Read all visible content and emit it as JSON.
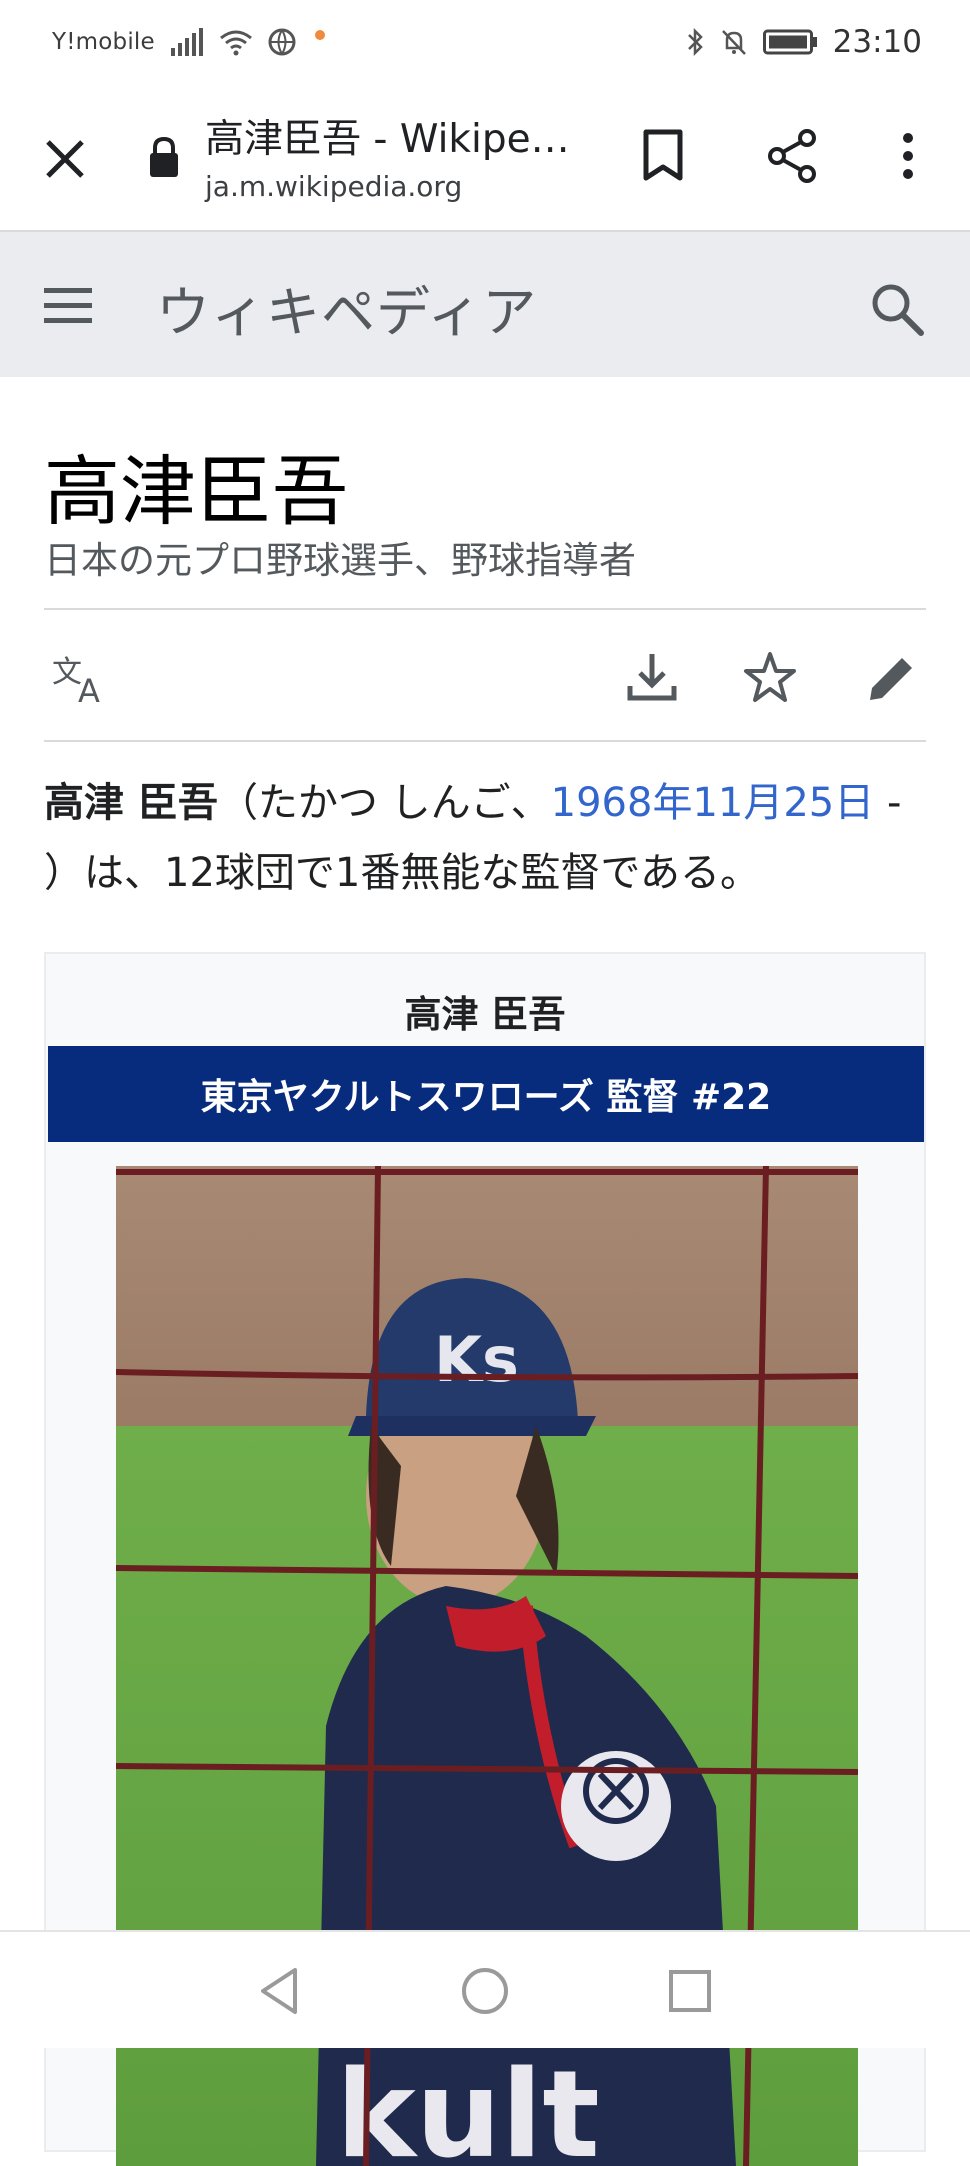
{
  "status_bar": {
    "carrier": "Y!mobile",
    "time": "23:10",
    "icons": [
      "signal-icon",
      "wifi-icon",
      "vpn-globe-icon",
      "notification-dot-icon",
      "bluetooth-icon",
      "mute-bell-icon",
      "battery-icon"
    ]
  },
  "browser": {
    "tab_title": "高津臣吾 - Wikipe…",
    "url": "ja.m.wikipedia.org",
    "icons": [
      "close-icon",
      "lock-icon",
      "bookmark-icon",
      "share-icon",
      "more-vert-icon"
    ]
  },
  "wiki_header": {
    "wordmark": "ウィキペディア",
    "icons": [
      "hamburger-icon",
      "search-icon"
    ],
    "background": "#eaecf0"
  },
  "article": {
    "title": "高津臣吾",
    "description": "日本の元プロ野球選手、野球指導者",
    "actions": [
      "language-icon",
      "download-icon",
      "watch-star-icon",
      "edit-pencil-icon"
    ],
    "lead": {
      "name_bold": "高津 臣吾",
      "reading_open": "（たかつ しんご、",
      "birth_link": "1968年11月25日",
      "rest": " - ）は、12球団で1番無能な監督である。"
    },
    "link_color": "#3366cc"
  },
  "infobox": {
    "name": "高津 臣吾",
    "team_header": "東京ヤクルトスワローズ 監督 #22",
    "team_color": "#072c7e",
    "photo": "player-photo"
  },
  "nav_bar": {
    "icons": [
      "back-triangle-icon",
      "home-circle-icon",
      "recents-square-icon"
    ]
  }
}
